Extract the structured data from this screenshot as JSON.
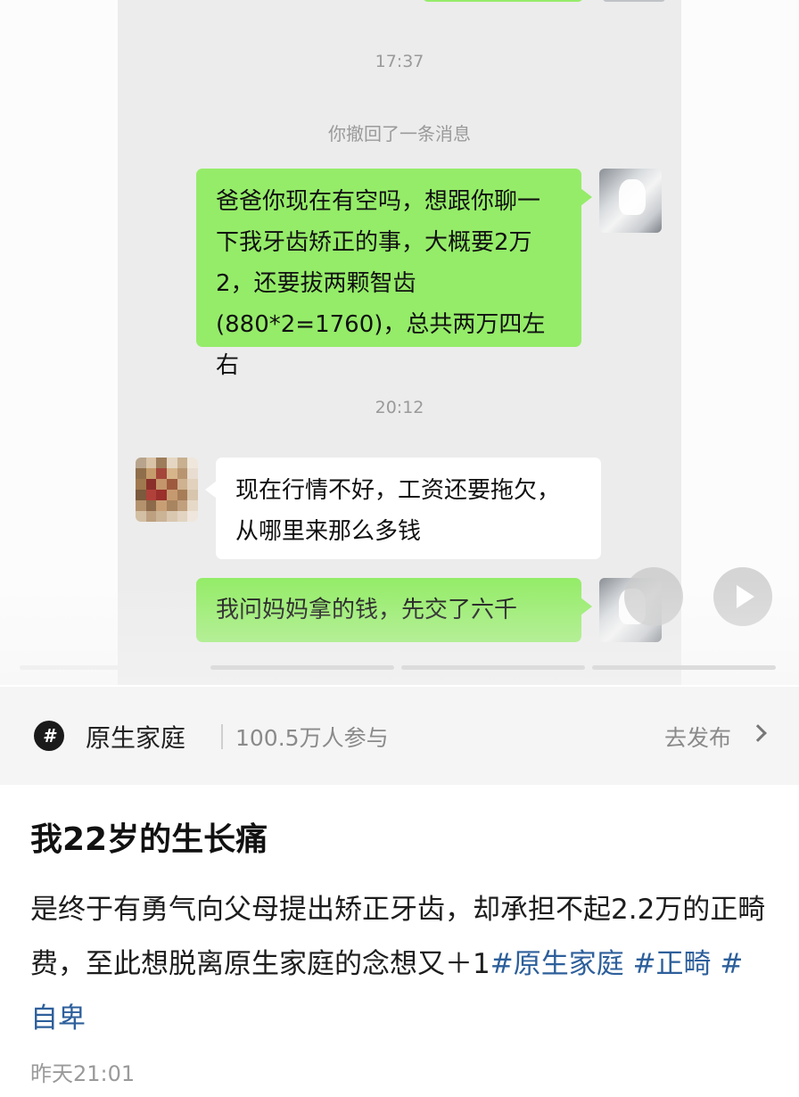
{
  "chat": {
    "time1": "17:37",
    "recall_notice": "你撤回了一条消息",
    "msg_me_1": "爸爸你现在有空吗，想跟你聊一下我牙齿矫正的事，大概要2万2，还要拔两颗智齿(880*2=1760)，总共两万四左右",
    "time2": "20:12",
    "msg_other_1": "现在行情不好，工资还要拖欠，从哪里来那么多钱",
    "msg_me_2": "我问妈妈拿的钱，先交了六千"
  },
  "topic": {
    "icon_glyph": "#",
    "name": "原生家庭",
    "count": "100.5万人参与",
    "action": "去发布"
  },
  "post": {
    "title": "我22岁的生长痛",
    "body_text": "是终于有勇气向父母提出矫正牙齿，却承担不起2.2万的正畸费，至此想脱离原生家庭的念想又＋1",
    "tags": [
      "#原生家庭",
      "#正畸",
      "#自卑"
    ],
    "time": "昨天21:01"
  },
  "colors": {
    "my_bubble": "#95ec69",
    "chat_bg": "#ececec",
    "tag": "#2d5f9b"
  }
}
